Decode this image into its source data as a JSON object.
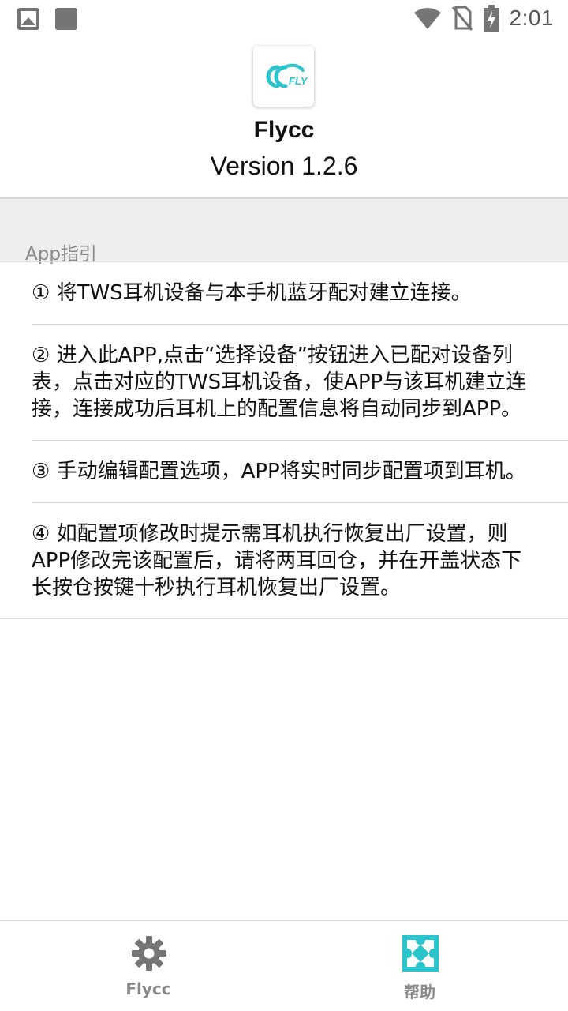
{
  "status_bar": {
    "time": "2:01",
    "left_icons": [
      "image-icon",
      "square-icon"
    ],
    "right_icons": [
      "wifi-icon",
      "no-sim-icon",
      "battery-charging-icon"
    ]
  },
  "header": {
    "app_name": "Flycc",
    "version": "Version 1.2.6",
    "logo_icon": "flycc-logo-icon"
  },
  "section": {
    "label": "App指引"
  },
  "guide": {
    "items": [
      "① 将TWS耳机设备与本手机蓝牙配对建立连接。",
      "② 进入此APP,点击“选择设备”按钮进入已配对设备列表，点击对应的TWS耳机设备，使APP与该耳机建立连接，连接成功后耳机上的配置信息将自动同步到APP。",
      "③ 手动编辑配置选项，APP将实时同步配置项到耳机。",
      "④ 如配置项修改时提示需耳机执行恢复出厂设置，则APP修改完该配置后，请将两耳回仓，并在开盖状态下长按仓按键十秒执行耳机恢复出厂设置。"
    ]
  },
  "bottom_nav": {
    "tabs": [
      {
        "label": "Flycc",
        "icon": "gear-icon",
        "active": false
      },
      {
        "label": "帮助",
        "icon": "help-puzzle-icon",
        "active": true
      }
    ],
    "active_color": "#29c4cc",
    "inactive_color": "#757575"
  },
  "colors": {
    "accent": "#29c4cc",
    "section_bg": "#eeeeee",
    "divider": "#dcdcdc"
  }
}
